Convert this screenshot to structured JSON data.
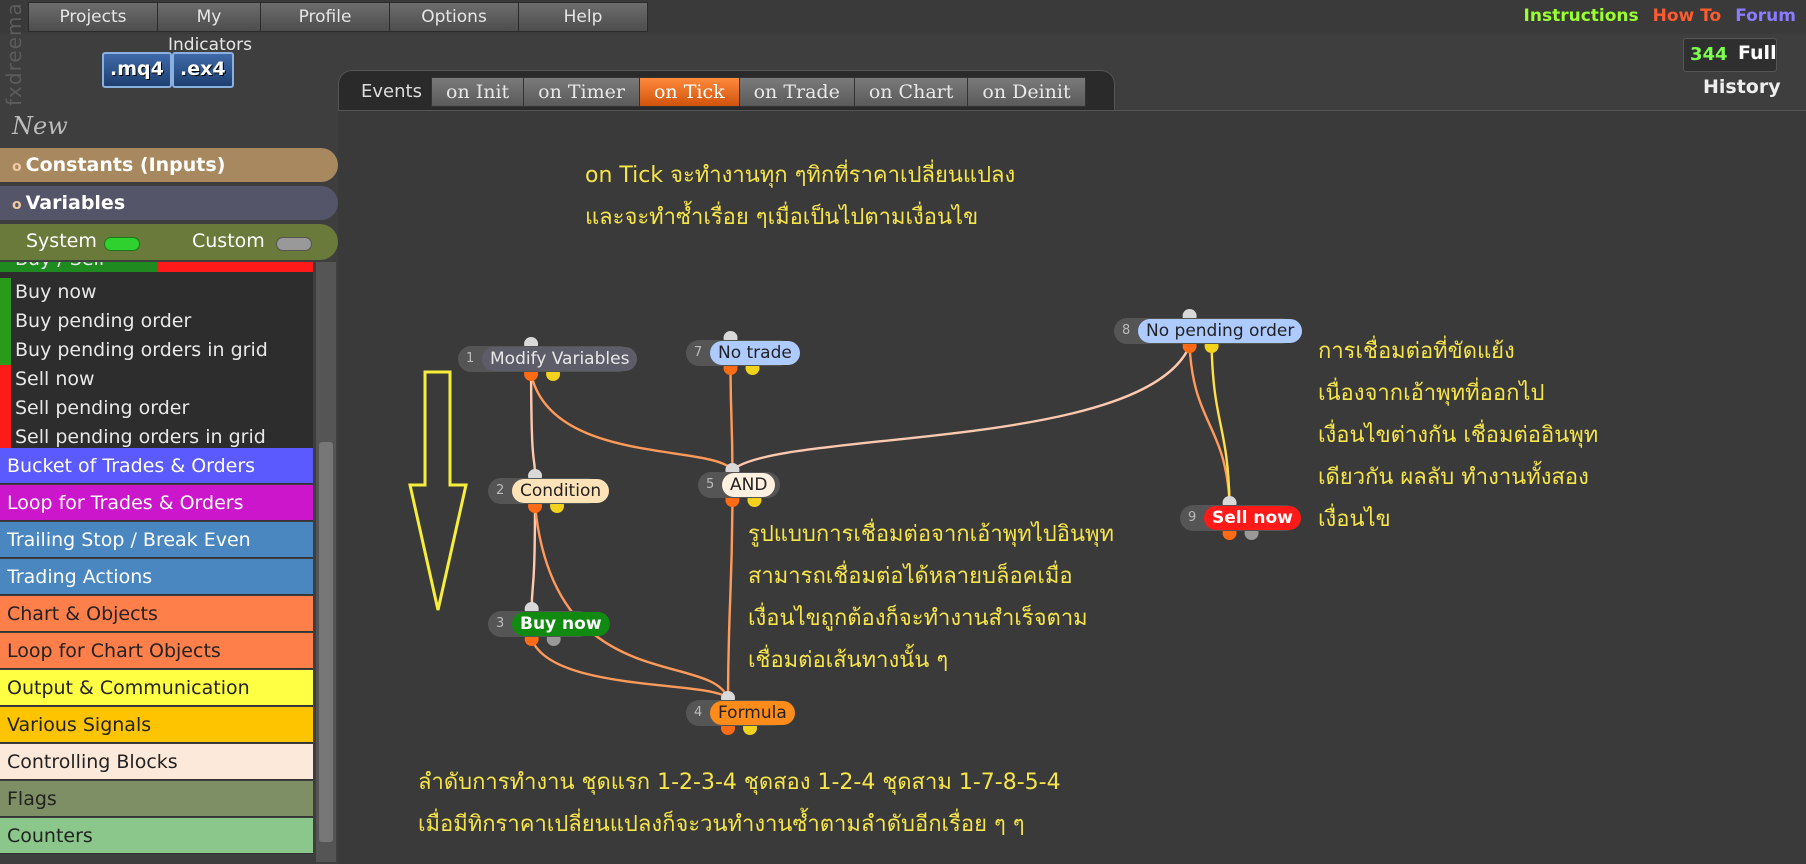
{
  "menu": [
    "Projects",
    "My Indicators",
    "Profile",
    "Options",
    "Help"
  ],
  "brand": "fxdreema",
  "file_buttons": [
    ".mq4",
    ".ex4"
  ],
  "top_links": [
    {
      "label": "Instructions",
      "color": "#9bff2e"
    },
    {
      "label": "How To",
      "color": "#ff5b2e"
    },
    {
      "label": "Forum",
      "color": "#8a7bff"
    }
  ],
  "counter": {
    "value": "344",
    "mode": "Full"
  },
  "history_label": "History",
  "tools_icon": "wrench-icon",
  "tabs": {
    "label": "Events",
    "items": [
      "on Init",
      "on Timer",
      "on Tick",
      "on Trade",
      "on Chart",
      "on Deinit"
    ],
    "active": "on Tick"
  },
  "sidebar": {
    "new_label": "New",
    "sections": [
      {
        "label": "Constants (Inputs)",
        "color": "#a8885e"
      },
      {
        "label": "Variables",
        "color": "#55556a"
      }
    ],
    "system_label": "System",
    "custom_label": "Custom",
    "group_header": "Buy / Sell",
    "sub_items": [
      {
        "label": "Buy now",
        "color": "#2a9a1a"
      },
      {
        "label": "Buy pending order",
        "color": "#2a9a1a"
      },
      {
        "label": "Buy pending orders in grid",
        "color": "#2a9a1a"
      },
      {
        "label": "Sell now",
        "color": "#ff1a1a"
      },
      {
        "label": "Sell pending order",
        "color": "#ff1a1a"
      },
      {
        "label": "Sell pending orders in grid",
        "color": "#ff1a1a"
      }
    ],
    "categories": [
      {
        "label": "Bucket of Trades & Orders",
        "color": "#5a5aff",
        "text": "#ffffff"
      },
      {
        "label": "Loop for Trades & Orders",
        "color": "#cc16cc",
        "text": "#ffffff"
      },
      {
        "label": "Trailing Stop / Break Even",
        "color": "#4a86bf",
        "text": "#ffffff"
      },
      {
        "label": "Trading Actions",
        "color": "#4a86bf",
        "text": "#ffffff"
      },
      {
        "label": "Chart & Objects",
        "color": "#ff7f4a",
        "text": "#222222"
      },
      {
        "label": "Loop for Chart Objects",
        "color": "#ff7f4a",
        "text": "#222222"
      },
      {
        "label": "Output & Communication",
        "color": "#ffff44",
        "text": "#222222"
      },
      {
        "label": "Various Signals",
        "color": "#ffc400",
        "text": "#222222"
      },
      {
        "label": "Controlling Blocks",
        "color": "#fde9d9",
        "text": "#222222"
      },
      {
        "label": "Flags",
        "color": "#7e8f66",
        "text": "#222222"
      },
      {
        "label": "Counters",
        "color": "#8bc68b",
        "text": "#222222"
      }
    ]
  },
  "nodes": [
    {
      "id": "1",
      "label": "Modify Variables",
      "bg": "#5d5d6a",
      "fg": "#e8e8e8"
    },
    {
      "id": "2",
      "label": "Condition",
      "bg": "#ffe3b8",
      "fg": "#222222"
    },
    {
      "id": "3",
      "label": "Buy now",
      "bg": "#118a11",
      "fg": "#ffffff"
    },
    {
      "id": "4",
      "label": "Formula",
      "bg": "#ff8c1a",
      "fg": "#222222"
    },
    {
      "id": "5",
      "label": "AND",
      "bg": "#fff0e0",
      "fg": "#222222"
    },
    {
      "id": "7",
      "label": "No trade",
      "bg": "#aecbff",
      "fg": "#222222"
    },
    {
      "id": "8",
      "label": "No pending order",
      "bg": "#aecbff",
      "fg": "#222222"
    },
    {
      "id": "9",
      "label": "Sell now",
      "bg": "#ff1a1a",
      "fg": "#ffffff"
    }
  ],
  "annotations": {
    "top": [
      "on Tick จะทำงานทุก ๆทิกที่ราคาเปลี่ยนแปลง",
      "และจะทำซ้ำเรื่อย ๆเมื่อเป็นไปตามเงื่อนไข"
    ],
    "middle": [
      "รูปแบบการเชื่อมต่อจากเอ้าพุทไปอินพุท",
      "สามารถเชื่อมต่อได้หลายบล็อคเมื่อ",
      "เงื่อนไขถูกต้องก็จะทำงานสำเร็จตาม",
      "เชื่อมต่อเส้นทางนั้น ๆ"
    ],
    "right": [
      "การเชื่อมต่อที่ขัดแย้ง",
      "เนื่องจากเอ้าพุทที่ออกไป",
      "เงื่อนไขต่างกัน เชื่อมต่ออินพุท",
      "เดียวกัน ผลลับ ทำงานทั้งสอง",
      "เงื่อนไข"
    ],
    "bottom": [
      "ลำดับการทำงาน ชุดแรก 1-2-3-4  ชุดสอง 1-2-4 ชุดสาม 1-7-8-5-4",
      "เมื่อมีทิกราคาเปลี่ยนแปลงก็จะวนทำงานซ้ำตามลำดับอีกเรื่อย ๆ ๆ"
    ]
  }
}
